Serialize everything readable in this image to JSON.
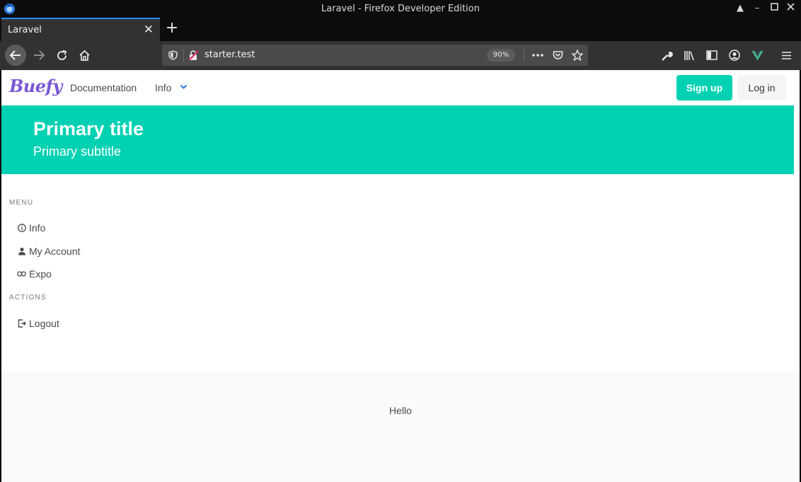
{
  "window": {
    "title": "Laravel - Firefox Developer Edition"
  },
  "tabs": [
    {
      "label": "Laravel",
      "active": true
    }
  ],
  "urlbar": {
    "url": "starter.test",
    "zoom": "90%"
  },
  "site": {
    "logo": "Buefy",
    "nav": {
      "documentation": "Documentation",
      "info": "Info"
    },
    "buttons": {
      "signup": "Sign up",
      "login": "Log in"
    },
    "hero": {
      "title": "Primary title",
      "subtitle": "Primary subtitle"
    },
    "menu": {
      "menu_label": "MENU",
      "items": [
        {
          "label": "Info",
          "icon": "info-circle-icon"
        },
        {
          "label": "My Account",
          "icon": "account-icon"
        },
        {
          "label": "Expo",
          "icon": "link-icon"
        }
      ],
      "actions_label": "ACTIONS",
      "actions": [
        {
          "label": "Logout",
          "icon": "logout-icon"
        }
      ]
    },
    "footer": {
      "text": "Hello"
    }
  },
  "colors": {
    "primary": "#00d1b2",
    "logo": "#7957d5",
    "link": "#3273dc"
  }
}
